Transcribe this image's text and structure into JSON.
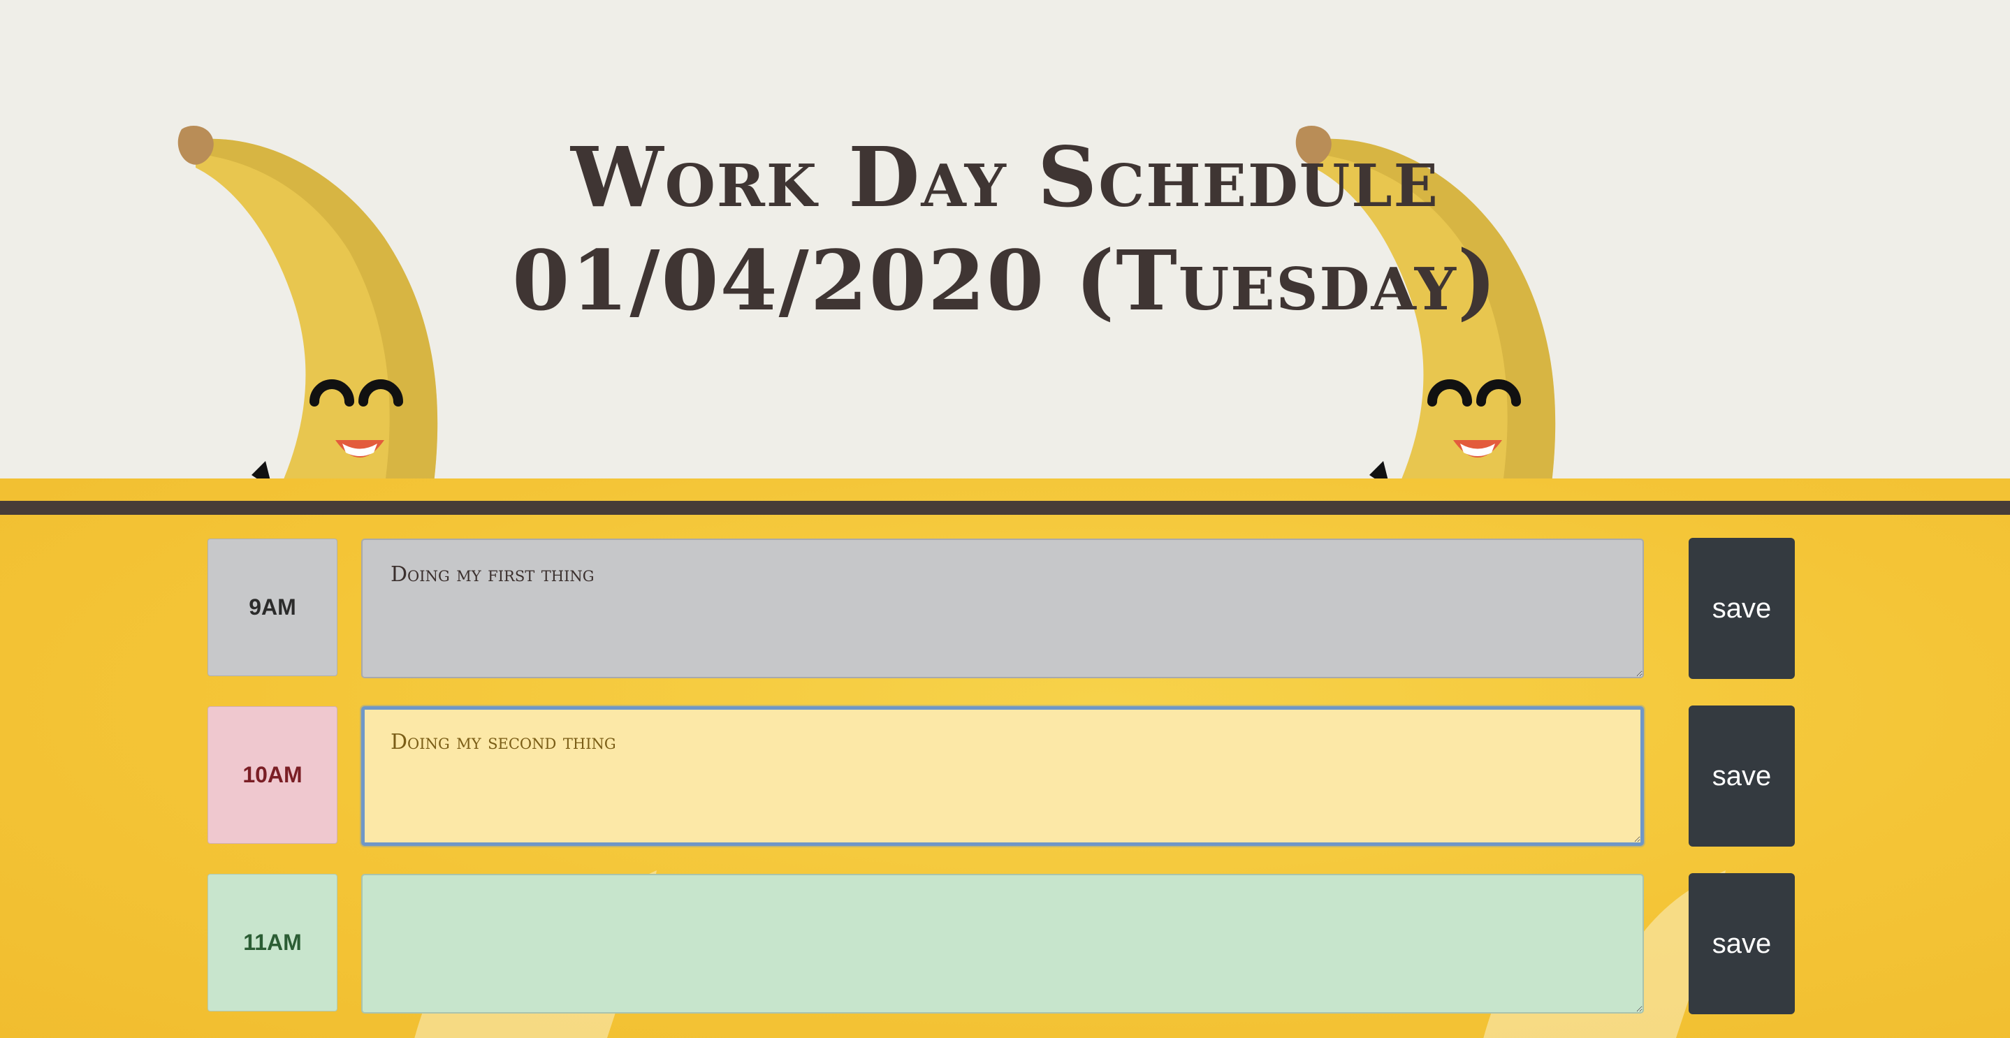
{
  "header": {
    "title": "Work Day Schedule",
    "date": "01/04/2020 (Tuesday)"
  },
  "rows": [
    {
      "hour": "9AM",
      "text": "Doing my first thing",
      "state": "past",
      "save_label": "save"
    },
    {
      "hour": "10AM",
      "text": "Doing my second thing",
      "state": "present",
      "save_label": "save"
    },
    {
      "hour": "11AM",
      "text": "",
      "state": "future",
      "save_label": "save"
    }
  ],
  "colors": {
    "header_background": "#efeee8",
    "title_text": "#3f3533",
    "divider": "#473c38",
    "planner_background": "#f4c537",
    "past": "#c6c7c9",
    "present_hour": "#efc8cf",
    "present_task": "#fce8a7",
    "future": "#c7e5cc",
    "save_button": "#343a40"
  },
  "icons": {
    "decoration": "banana-character-icon"
  }
}
